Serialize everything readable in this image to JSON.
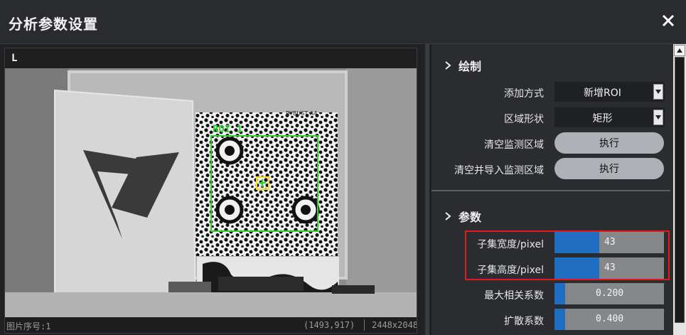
{
  "window": {
    "title": "分析参数设置",
    "close_icon": "close-icon"
  },
  "image_panel": {
    "label": "L",
    "roi_label": "ROI 1",
    "target_text": "RYBUST A4",
    "status": {
      "image_index": "图片序号:1",
      "cursor": "(1493,917)",
      "resolution": "2448x2048"
    }
  },
  "draw_section": {
    "title": "绘制",
    "add_mode": {
      "label": "添加方式",
      "value": "新增ROI"
    },
    "region_shape": {
      "label": "区域形状",
      "value": "矩形"
    },
    "clear_monitor": {
      "label": "清空监测区域",
      "button": "执行"
    },
    "clear_import_monitor": {
      "label": "清空并导入监测区域",
      "button": "执行"
    }
  },
  "params_section": {
    "title": "参数",
    "subset_width": {
      "label": "子集宽度/pixel",
      "value": "43",
      "fill": 0.41
    },
    "subset_height": {
      "label": "子集高度/pixel",
      "value": "43",
      "fill": 0.41
    },
    "max_corr": {
      "label": "最大相关系数",
      "value": "0.200",
      "fill": 0.1
    },
    "diffusion": {
      "label": "扩散系数",
      "value": "0.400",
      "fill": 0.1
    }
  },
  "colors": {
    "accent": "#1f6ec1",
    "highlight": "#e21a1a",
    "roi": "#2ed12e",
    "marker": "#f0e020"
  }
}
